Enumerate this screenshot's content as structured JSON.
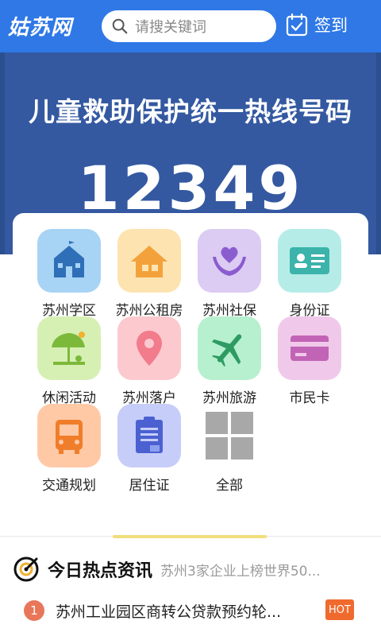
{
  "header": {
    "logo_text": "姑苏网",
    "search_placeholder": "请搜关键词",
    "checkin_label": "签到"
  },
  "banner": {
    "title": "儿童救助保护统一热线号码",
    "number": "12349"
  },
  "services": [
    {
      "label": "苏州学区",
      "color": "#a7d3f5",
      "icon": "school-icon"
    },
    {
      "label": "苏州公租房",
      "color": "#fde3b0",
      "icon": "house-icon"
    },
    {
      "label": "苏州社保",
      "color": "#dccbf2",
      "icon": "heart-hands-icon"
    },
    {
      "label": "身份证",
      "color": "#b5ece8",
      "icon": "id-card-icon"
    },
    {
      "label": "休闲活动",
      "color": "#d6f0b4",
      "icon": "umbrella-icon"
    },
    {
      "label": "苏州落户",
      "color": "#fcc9cf",
      "icon": "location-pin-icon"
    },
    {
      "label": "苏州旅游",
      "color": "#b7f0cf",
      "icon": "airplane-icon"
    },
    {
      "label": "市民卡",
      "color": "#f0c9ea",
      "icon": "card-icon"
    },
    {
      "label": "交通规划",
      "color": "#ffc9a6",
      "icon": "bus-icon"
    },
    {
      "label": "居住证",
      "color": "#c6cdf8",
      "icon": "document-icon"
    },
    {
      "label": "全部",
      "color": "#ffffff",
      "icon": "grid-icon"
    }
  ],
  "news": {
    "section_title": "今日热点资讯",
    "ticker": "苏州3家企业上榜世界50...",
    "items": [
      {
        "rank": "1",
        "title": "苏州工业园区商转公贷款预约轮...",
        "badge": "HOT"
      }
    ]
  },
  "colors": {
    "header_bg": "#2f78e6",
    "banner_bg": "#3459a1",
    "hot_badge": "#f06a2e",
    "rank_badge": "#e8775a"
  }
}
